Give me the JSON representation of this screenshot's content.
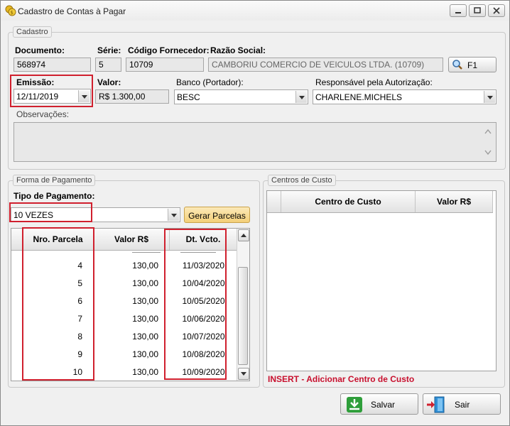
{
  "window": {
    "title": "Cadastro de Contas à Pagar"
  },
  "cadastro": {
    "legend": "Cadastro",
    "documento_label": "Documento:",
    "documento_value": "568974",
    "serie_label": "Série:",
    "serie_value": "5",
    "codigo_fornecedor_label": "Código Fornecedor:",
    "codigo_fornecedor_value": "10709",
    "razao_social_label": "Razão Social:",
    "razao_social_value": "CAMBORIU COMERCIO DE VEICULOS LTDA. (10709)",
    "f1_label": "F1",
    "emissao_label": "Emissão:",
    "emissao_value": "12/11/2019",
    "valor_label": "Valor:",
    "valor_value": "R$ 1.300,00",
    "banco_label": "Banco (Portador):",
    "banco_value": "BESC",
    "responsavel_label": "Responsável pela Autorização:",
    "responsavel_value": "CHARLENE.MICHELS",
    "observacoes_label": "Observações:",
    "observacoes_value": ""
  },
  "pagamento": {
    "legend": "Forma de Pagamento",
    "tipo_label": "Tipo de Pagamento:",
    "tipo_value": "10 VEZES",
    "gerar_label": "Gerar Parcelas",
    "columns": [
      "Nro. Parcela",
      "Valor R$",
      "Dt. Vcto."
    ],
    "rows": [
      {
        "parcela": "4",
        "valor": "130,00",
        "vcto": "11/03/2020"
      },
      {
        "parcela": "5",
        "valor": "130,00",
        "vcto": "10/04/2020"
      },
      {
        "parcela": "6",
        "valor": "130,00",
        "vcto": "10/05/2020"
      },
      {
        "parcela": "7",
        "valor": "130,00",
        "vcto": "10/06/2020"
      },
      {
        "parcela": "8",
        "valor": "130,00",
        "vcto": "10/07/2020"
      },
      {
        "parcela": "9",
        "valor": "130,00",
        "vcto": "10/08/2020"
      },
      {
        "parcela": "10",
        "valor": "130,00",
        "vcto": "10/09/2020"
      }
    ]
  },
  "centros": {
    "legend": "Centros de Custo",
    "columns": [
      "Centro de Custo",
      "Valor R$"
    ],
    "insert_hint": "INSERT - Adicionar Centro de Custo"
  },
  "actions": {
    "salvar_label": "Salvar",
    "sair_label": "Sair"
  },
  "colors": {
    "highlight": "#d0202e",
    "insert_hint": "#c8102e",
    "salvar_icon": "#2e9e3a",
    "gerar_button": "#f7d88a"
  }
}
